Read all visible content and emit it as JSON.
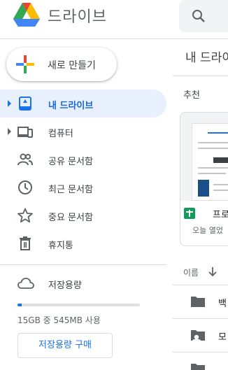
{
  "app": {
    "title": "드라이브"
  },
  "sidebar": {
    "new_button": {
      "label": "새로 만들기"
    },
    "items": [
      {
        "label": "내 드라이브",
        "icon": "my-drive-icon",
        "expandable": true,
        "active": true
      },
      {
        "label": "컴퓨터",
        "icon": "computers-icon",
        "expandable": true,
        "active": false
      },
      {
        "label": "공유 문서함",
        "icon": "shared-people-icon",
        "expandable": false,
        "active": false
      },
      {
        "label": "최근 문서함",
        "icon": "clock-icon",
        "expandable": false,
        "active": false
      },
      {
        "label": "중요 문서함",
        "icon": "star-icon",
        "expandable": false,
        "active": false
      },
      {
        "label": "휴지통",
        "icon": "trash-icon",
        "expandable": false,
        "active": false
      }
    ],
    "storage": {
      "title": "저장용량",
      "usage_text": "15GB 중 545MB 사용",
      "used_fraction": 0.036,
      "buy_button": "저장용량 구매"
    }
  },
  "main": {
    "title": "내 드라이",
    "section": "추천",
    "suggested_card": {
      "name": "프로",
      "subtitle": "오늘 열었"
    },
    "list_header": "이름",
    "rows": [
      {
        "name": "백",
        "type": "folder"
      },
      {
        "name": "모",
        "type": "shared-folder"
      },
      {
        "name": "",
        "type": "folder"
      }
    ]
  },
  "colors": {
    "accent": "#1a73e8",
    "active_bg": "#e8f0fe",
    "sheets_green": "#0f9d58"
  }
}
